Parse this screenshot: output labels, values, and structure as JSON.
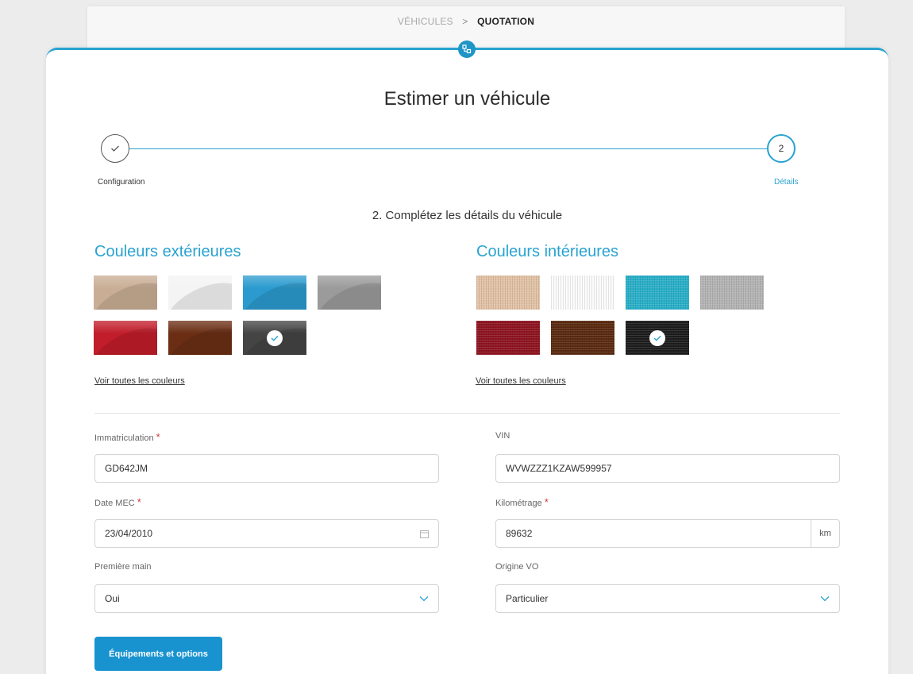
{
  "breadcrumb": {
    "vehicles": "VÉHICULES",
    "separator": ">",
    "current": "QUOTATION"
  },
  "page": {
    "title": "Estimer un véhicule",
    "subtitle": "2. Complétez les détails du véhicule"
  },
  "stepper": {
    "step1_label": "Configuration",
    "step1_icon": "check-icon",
    "step2_number": "2",
    "step2_label": "Détails"
  },
  "exterior": {
    "title": "Couleurs extérieures",
    "link": "Voir toutes les couleurs",
    "colors": [
      "#c9ae95",
      "#f4f4f4",
      "#2b9bcf",
      "#9b9b9b",
      "#c11d2a",
      "#6b2e14",
      "#444444"
    ],
    "selected_index": 6
  },
  "interior": {
    "title": "Couleurs intérieures",
    "link": "Voir toutes les couleurs",
    "colors": [
      "#e2c3a6",
      "#fbfbfb",
      "#2ab0c9",
      "#b4b4b4",
      "#8e1420",
      "#5a2a10",
      "#1c1c1c"
    ],
    "selected_index": 6
  },
  "form": {
    "immatriculation": {
      "label": "Immatriculation",
      "required": "*",
      "value": "GD642JM"
    },
    "vin": {
      "label": "VIN",
      "value": "WVWZZZ1KZAW599957"
    },
    "date_mec": {
      "label": "Date MEC",
      "required": "*",
      "value": "23/04/2010",
      "icon": "calendar-icon"
    },
    "kilometrage": {
      "label": "Kilométrage",
      "required": "*",
      "value": "89632",
      "unit": "km"
    },
    "premiere_main": {
      "label": "Première main",
      "value": "Oui",
      "icon": "chevron-down-icon"
    },
    "origine_vo": {
      "label": "Origine VO",
      "value": "Particulier",
      "icon": "chevron-down-icon"
    }
  },
  "actions": {
    "equipments": "Équipements et options"
  },
  "colors": {
    "accent": "#29a3cf",
    "button": "#1893d0",
    "required": "#d0393b"
  }
}
